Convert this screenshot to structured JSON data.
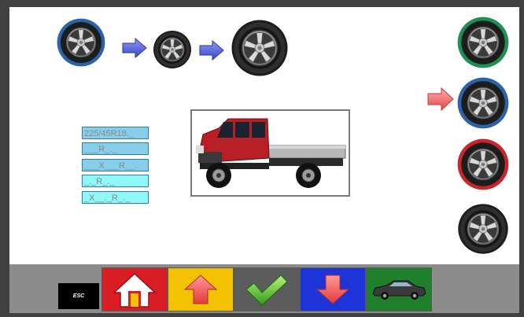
{
  "colors": {
    "panel_bg": "#ffffff",
    "frame_bg": "#404040",
    "toolbar_bg": "#8c8c8c",
    "ring_blue": "#2b62a8",
    "ring_green": "#1f8f55",
    "ring_red": "#c8262c",
    "ring_black": "#222222",
    "arrow_blue": "#5c68e0",
    "arrow_red": "#f06a6a",
    "home_button": "#d81d24",
    "up_button": "#f2c200",
    "ok_button": "#5c5c5c",
    "down_button": "#1d35d8",
    "car_button": "#1f7f2a"
  },
  "sequence": {
    "items": [
      "wheel-blue-large",
      "arrow-right-blue",
      "wheel-plain-small",
      "arrow-right-blue",
      "wheel-black-large"
    ]
  },
  "selector": {
    "wheels": [
      {
        "ring": "green",
        "selected": false
      },
      {
        "ring": "blue",
        "selected": true
      },
      {
        "ring": "red",
        "selected": false
      },
      {
        "ring": "black",
        "selected": false
      }
    ],
    "pointer_icon": "arrow-right-red"
  },
  "tire_sizes": {
    "fields": [
      {
        "value": "225/45R18._",
        "style": "blue"
      },
      {
        "value": "___R_._",
        "style": "blue"
      },
      {
        "value": "___X___R__.",
        "style": "blue"
      },
      {
        "value": "_._R_._",
        "style": "cyan"
      },
      {
        "value": "_X__._R_._",
        "style": "cyan"
      }
    ]
  },
  "vehicle": {
    "icon": "pickup-truck-icon"
  },
  "toolbar": {
    "esc_label": "ESC",
    "buttons": [
      {
        "name": "home-button",
        "icon": "home-icon"
      },
      {
        "name": "up-button",
        "icon": "arrow-up-icon"
      },
      {
        "name": "confirm-button",
        "icon": "checkmark-icon"
      },
      {
        "name": "down-button",
        "icon": "arrow-down-icon"
      },
      {
        "name": "vehicle-button",
        "icon": "car-icon"
      }
    ]
  }
}
